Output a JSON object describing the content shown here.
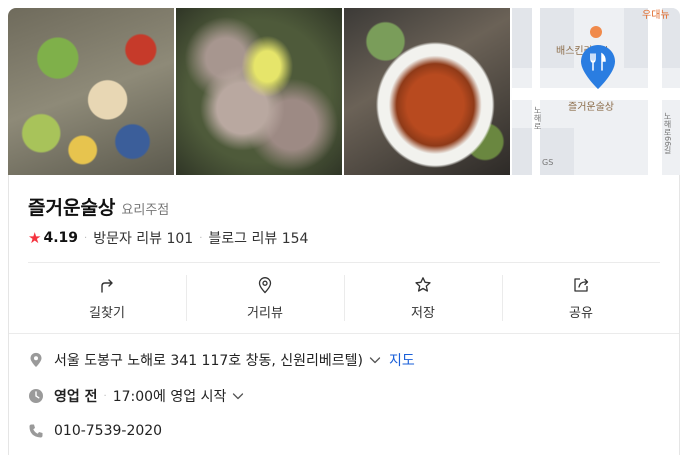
{
  "photos": [
    {
      "name": "food-photo-banchan"
    },
    {
      "name": "food-photo-octopus"
    },
    {
      "name": "food-photo-stir-fry"
    }
  ],
  "map": {
    "labels": {
      "top_right": "우대뉴",
      "poi": "배스킨라빈스",
      "place": "즐거운술상",
      "road_vertical": "노해로66길",
      "road_left": "노해로",
      "gs": "GS"
    },
    "pin_color": "#2a7de1",
    "poi_color": "#f08a4b"
  },
  "place": {
    "name": "즐거운술상",
    "category": "요리주점",
    "rating": "4.19",
    "visitor_reviews": "방문자 리뷰 101",
    "blog_reviews": "블로그 리뷰 154",
    "star_color": "#f5333f"
  },
  "actions": [
    {
      "label": "길찾기",
      "icon": "directions-icon"
    },
    {
      "label": "거리뷰",
      "icon": "street-view-icon"
    },
    {
      "label": "저장",
      "icon": "star-outline-icon"
    },
    {
      "label": "공유",
      "icon": "share-icon"
    }
  ],
  "info": {
    "address": "서울 도봉구 노해로 341 117호 창동, 신원리베르텔)",
    "map_link": "지도",
    "status": "영업 전",
    "hours": "17:00에 영업 시작",
    "phone": "010-7539-2020",
    "link_color": "#1a5fd8"
  }
}
